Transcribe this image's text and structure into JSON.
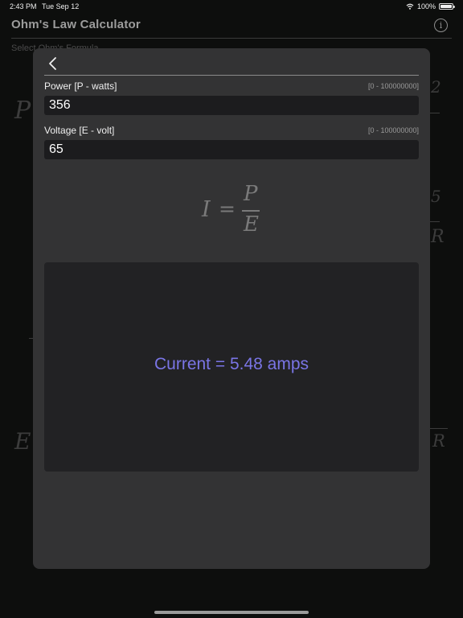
{
  "status_bar": {
    "time": "2:43 PM",
    "date": "Tue Sep 12",
    "battery": "100%"
  },
  "background_app": {
    "title": "Ohm's Law Calculator",
    "subtitle": "Select Ohm's Formula",
    "glyphs": {
      "p": "P",
      "e": "E",
      "r1": "R",
      "r2": "R",
      "r3": "R",
      "five": "5",
      "two": "2"
    }
  },
  "modal": {
    "fields": [
      {
        "label": "Power [P - watts]",
        "range": "[0 - 100000000]",
        "value": "356"
      },
      {
        "label": "Voltage [E - volt]",
        "range": "[0 - 100000000]",
        "value": "65"
      }
    ],
    "formula": {
      "lhs": "I",
      "eq": "=",
      "numerator": "P",
      "denominator": "E"
    },
    "result": "Current = 5.48 amps"
  },
  "colors": {
    "result_text": "#7a75e6",
    "modal_bg": "#333334",
    "input_bg": "#1c1c1e"
  },
  "icons": [
    "wifi-icon",
    "battery-icon",
    "info-icon",
    "chevron-left-icon"
  ]
}
